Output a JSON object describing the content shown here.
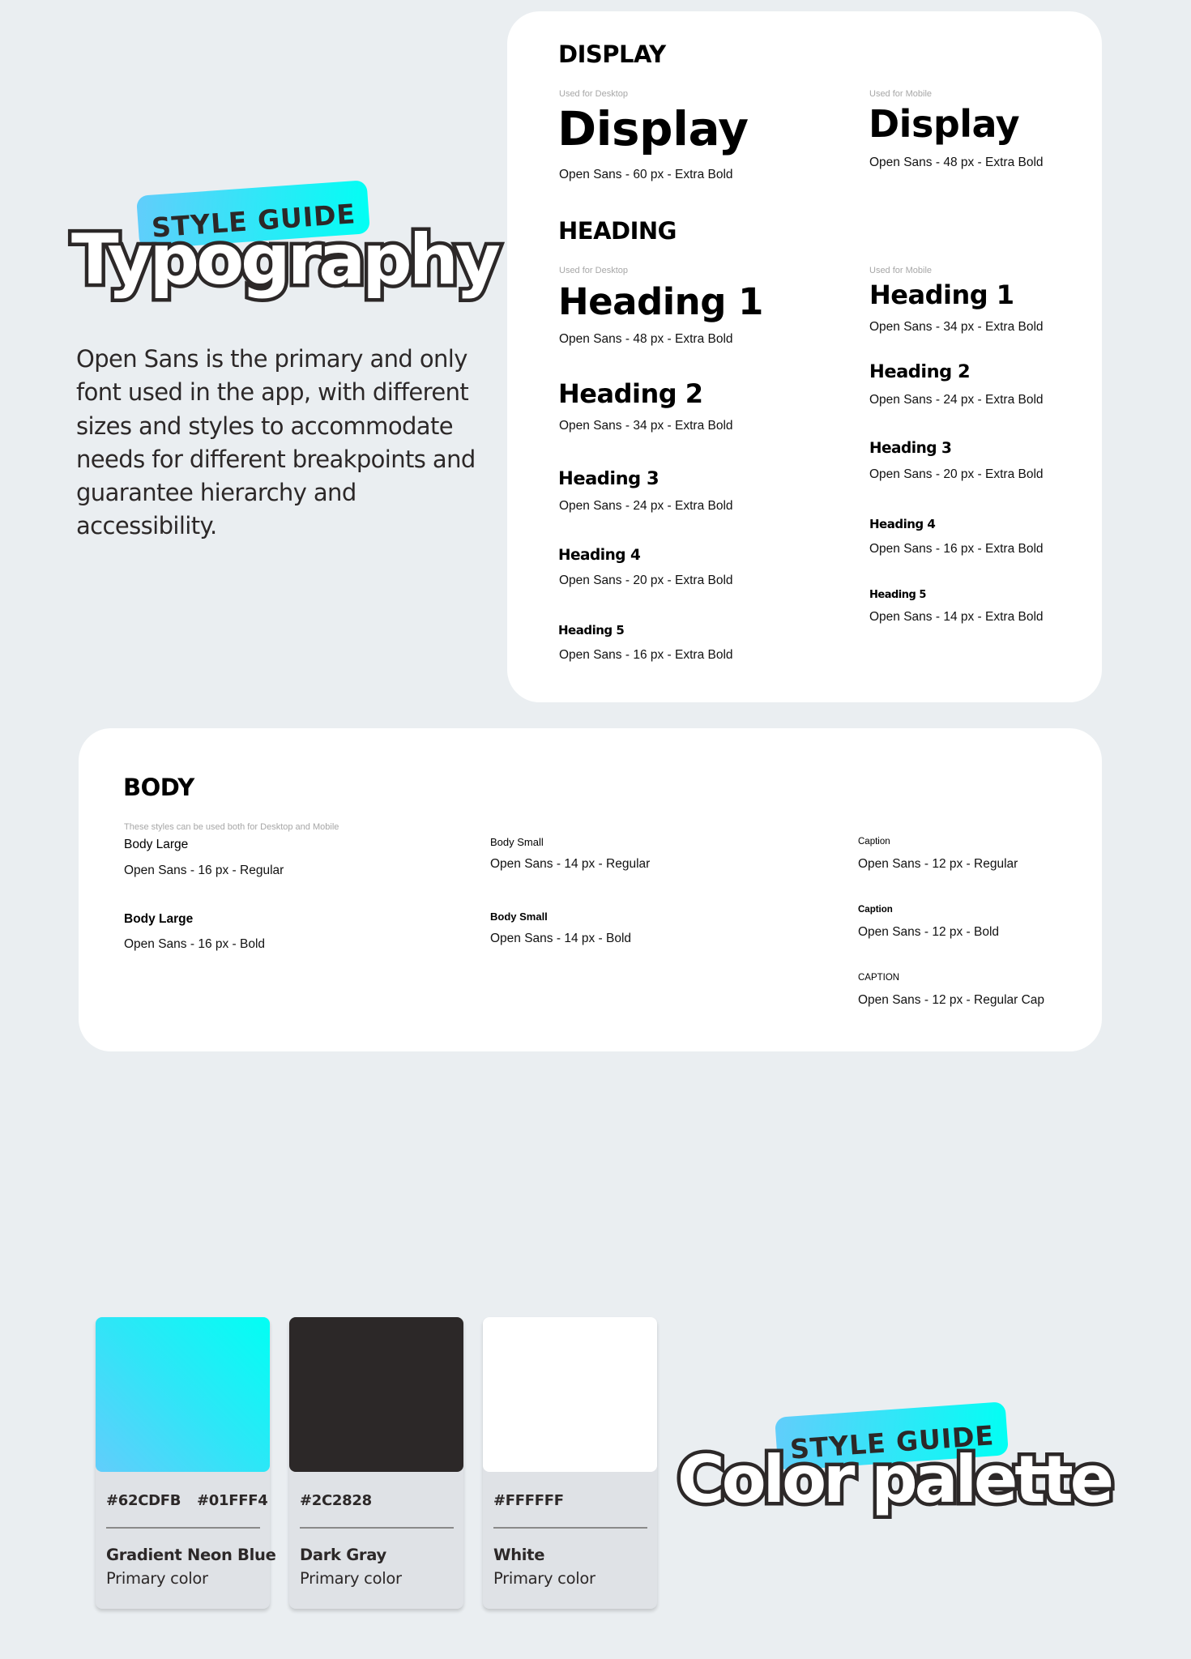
{
  "typography_hero": {
    "badge": "STYLE GUIDE",
    "title": "Typography",
    "intro": "Open Sans is the primary and only font used in the app, with different sizes and styles to accommodate needs for different breakpoints and guarantee hierarchy and accessibility."
  },
  "display": {
    "title": "DISPLAY",
    "desktop": {
      "used_for": "Used for Desktop",
      "sample": "Display",
      "spec": "Open Sans - 60 px - Extra Bold"
    },
    "mobile": {
      "used_for": "Used for Mobile",
      "sample": "Display",
      "spec": "Open Sans - 48 px - Extra Bold"
    }
  },
  "heading": {
    "title": "HEADING",
    "desktop": {
      "used_for": "Used for Desktop",
      "items": [
        {
          "sample": "Heading 1",
          "spec": "Open Sans - 48 px - Extra Bold"
        },
        {
          "sample": "Heading 2",
          "spec": "Open Sans - 34 px - Extra Bold"
        },
        {
          "sample": "Heading 3",
          "spec": "Open Sans - 24 px - Extra Bold"
        },
        {
          "sample": "Heading 4",
          "spec": "Open Sans - 20 px - Extra Bold"
        },
        {
          "sample": "Heading 5",
          "spec": "Open Sans - 16 px - Extra Bold"
        }
      ]
    },
    "mobile": {
      "used_for": "Used for Mobile",
      "items": [
        {
          "sample": "Heading 1",
          "spec": "Open Sans - 34 px - Extra Bold"
        },
        {
          "sample": "Heading 2",
          "spec": "Open Sans - 24 px - Extra Bold"
        },
        {
          "sample": "Heading 3",
          "spec": "Open Sans - 20 px - Extra Bold"
        },
        {
          "sample": "Heading 4",
          "spec": "Open Sans - 16 px - Extra Bold"
        },
        {
          "sample": "Heading 5",
          "spec": "Open Sans - 14 px - Extra Bold"
        }
      ]
    }
  },
  "body": {
    "title": "BODY",
    "note": "These styles can be used both for Desktop and Mobile",
    "large": [
      {
        "sample": "Body Large",
        "spec": "Open Sans - 16 px - Regular"
      },
      {
        "sample": "Body Large",
        "spec": "Open Sans - 16 px - Bold"
      }
    ],
    "small": [
      {
        "sample": "Body Small",
        "spec": "Open Sans - 14 px - Regular"
      },
      {
        "sample": "Body Small",
        "spec": "Open Sans - 14 px - Bold"
      }
    ],
    "caption": [
      {
        "sample": "Caption",
        "spec": "Open Sans - 12 px - Regular"
      },
      {
        "sample": "Caption",
        "spec": "Open Sans - 12 px - Bold"
      },
      {
        "sample": "CAPTION",
        "spec": "Open Sans - 12 px - Regular Cap"
      }
    ]
  },
  "color_hero": {
    "badge": "STYLE GUIDE",
    "title": "Color palette"
  },
  "colors": [
    {
      "name": "Gradient Neon Blue",
      "role": "Primary color",
      "hex": [
        "#62CDFB",
        "#01FFF4"
      ]
    },
    {
      "name": "Dark Gray",
      "role": "Primary color",
      "hex": [
        "#2C2828"
      ]
    },
    {
      "name": "White",
      "role": "Primary color",
      "hex": [
        "#FFFFFF"
      ]
    }
  ]
}
